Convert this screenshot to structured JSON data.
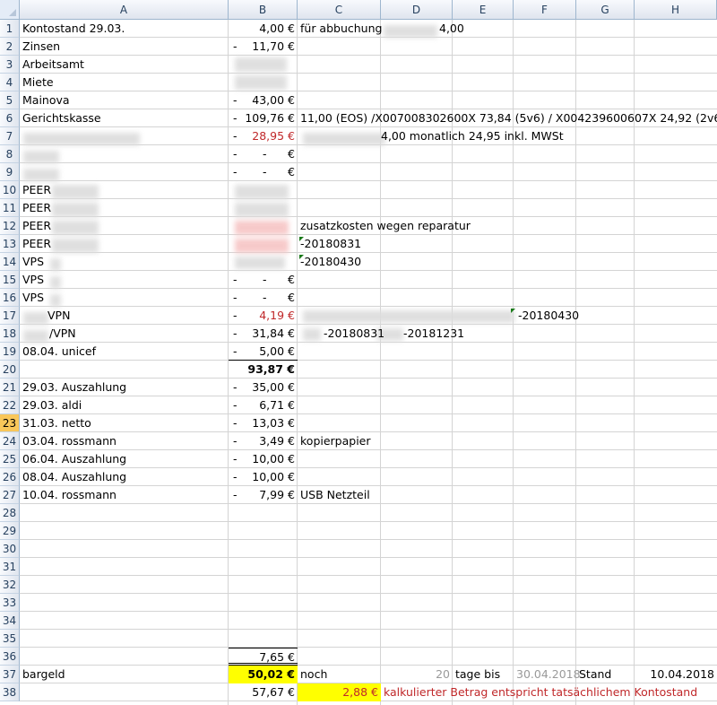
{
  "columns": [
    "A",
    "B",
    "C",
    "D",
    "E",
    "F",
    "G",
    "H"
  ],
  "rows": [
    "1",
    "2",
    "3",
    "4",
    "5",
    "6",
    "7",
    "8",
    "9",
    "10",
    "11",
    "12",
    "13",
    "14",
    "15",
    "16",
    "17",
    "18",
    "19",
    "20",
    "21",
    "22",
    "23",
    "24",
    "25",
    "26",
    "27",
    "28",
    "29",
    "30",
    "31",
    "32",
    "33",
    "34",
    "35",
    "36",
    "37",
    "38"
  ],
  "active_row": "23",
  "cells": {
    "A1": "Kontostand 29.03.",
    "B1": "4,00 €",
    "C1": "für abbuchung",
    "D1": "4,00",
    "A2": "Zinsen",
    "B2": "11,70 €",
    "A3": "Arbeitsamt",
    "A4": "Miete",
    "A5": "Mainova",
    "B5": "43,00 €",
    "A6": "Gerichtskasse",
    "B6": "109,76 €",
    "C6": "11,00 (EOS) /X007008302600X 73,84 (5v6) / X004239600607X 24,92 (2v6)",
    "B7": "28,95 €",
    "C7": "4,00 monatlich 24,95 inkl. MWSt",
    "B8": "€",
    "B9": "€",
    "A10": "PEER",
    "A11": "PEER",
    "A12": "PEER",
    "C12": "zusatzkosten wegen reparatur",
    "A13": "PEER",
    "C13": "-20180831",
    "A14": "VPS",
    "C14": "-20180430",
    "A15": "VPS",
    "B15": "€",
    "A16": "VPS",
    "B16": "€",
    "A17": "VPN",
    "B17": "4,19 €",
    "F17": "-20180430",
    "A18": "/VPN",
    "B18": "31,84 €",
    "C18": "-20180831",
    "D18": "-20181231",
    "A19": "08.04. unicef",
    "B19": "5,00 €",
    "B20": "93,87 €",
    "A21": "29.03. Auszahlung",
    "B21": "35,00 €",
    "A22": "29.03. aldi",
    "B22": "6,71 €",
    "A23": "31.03. netto",
    "B23": "13,03 €",
    "A24": "03.04. rossmann",
    "B24": "3,49 €",
    "C24": "kopierpapier",
    "A25": "06.04. Auszahlung",
    "B25": "10,00 €",
    "A26": "08.04. Auszahlung",
    "B26": "10,00 €",
    "A27": "10.04. rossmann",
    "B27": "7,99 €",
    "C27": "USB Netzteil",
    "B36": "7,65 €",
    "A37": "bargeld",
    "B37": "50,02 €",
    "C37": "noch",
    "D37": "20",
    "E37": "tage bis",
    "F37": "30.04.2018",
    "G37": "Stand",
    "H37": "10.04.2018",
    "B38": "57,67 €",
    "C38": "2,88 €",
    "D38": "kalkulierter Betrag entspricht tatsächlichem Kontostand"
  },
  "dash": "-",
  "colors": {
    "red": "#c0282a",
    "highlight": "#ffff00",
    "header_bg": "#dfe5ee",
    "active_row": "#f9c75a"
  }
}
